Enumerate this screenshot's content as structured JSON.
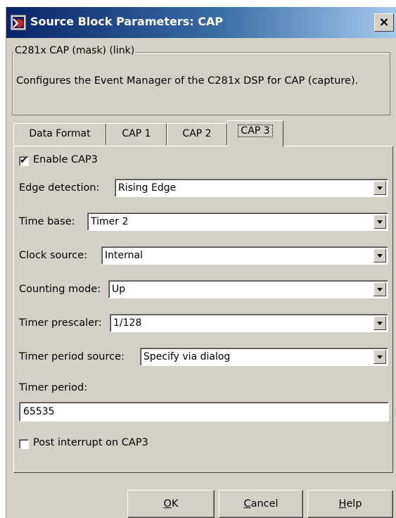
{
  "window": {
    "title": "Source Block Parameters: CAP",
    "close_label": "×"
  },
  "group": {
    "legend": "C281x CAP (mask) (link)",
    "description": "Configures the Event Manager of the C281x DSP for CAP (capture)."
  },
  "tabs": [
    {
      "label": "Data Format",
      "active": false
    },
    {
      "label": "CAP 1",
      "active": false
    },
    {
      "label": "CAP 2",
      "active": false
    },
    {
      "label": "CAP 3",
      "active": true
    }
  ],
  "form": {
    "enable": {
      "label": "Enable CAP3",
      "checked": true
    },
    "edge_detection": {
      "label": "Edge detection:",
      "value": "Rising Edge"
    },
    "time_base": {
      "label": "Time base:",
      "value": "Timer 2"
    },
    "clock_source": {
      "label": "Clock source:",
      "value": "Internal"
    },
    "counting_mode": {
      "label": "Counting mode:",
      "value": "Up"
    },
    "timer_prescaler": {
      "label": "Timer prescaler:",
      "value": "1/128"
    },
    "timer_period_source": {
      "label": "Timer period source:",
      "value": "Specify via dialog"
    },
    "timer_period": {
      "label": "Timer period:",
      "value": "65535"
    },
    "post_interrupt": {
      "label": "Post interrupt on CAP3",
      "checked": false
    }
  },
  "buttons": {
    "ok": {
      "mnemonic": "O",
      "rest": "K"
    },
    "cancel": {
      "mnemonic": "C",
      "rest": "ancel"
    },
    "help": {
      "mnemonic": "H",
      "rest": "elp"
    }
  }
}
